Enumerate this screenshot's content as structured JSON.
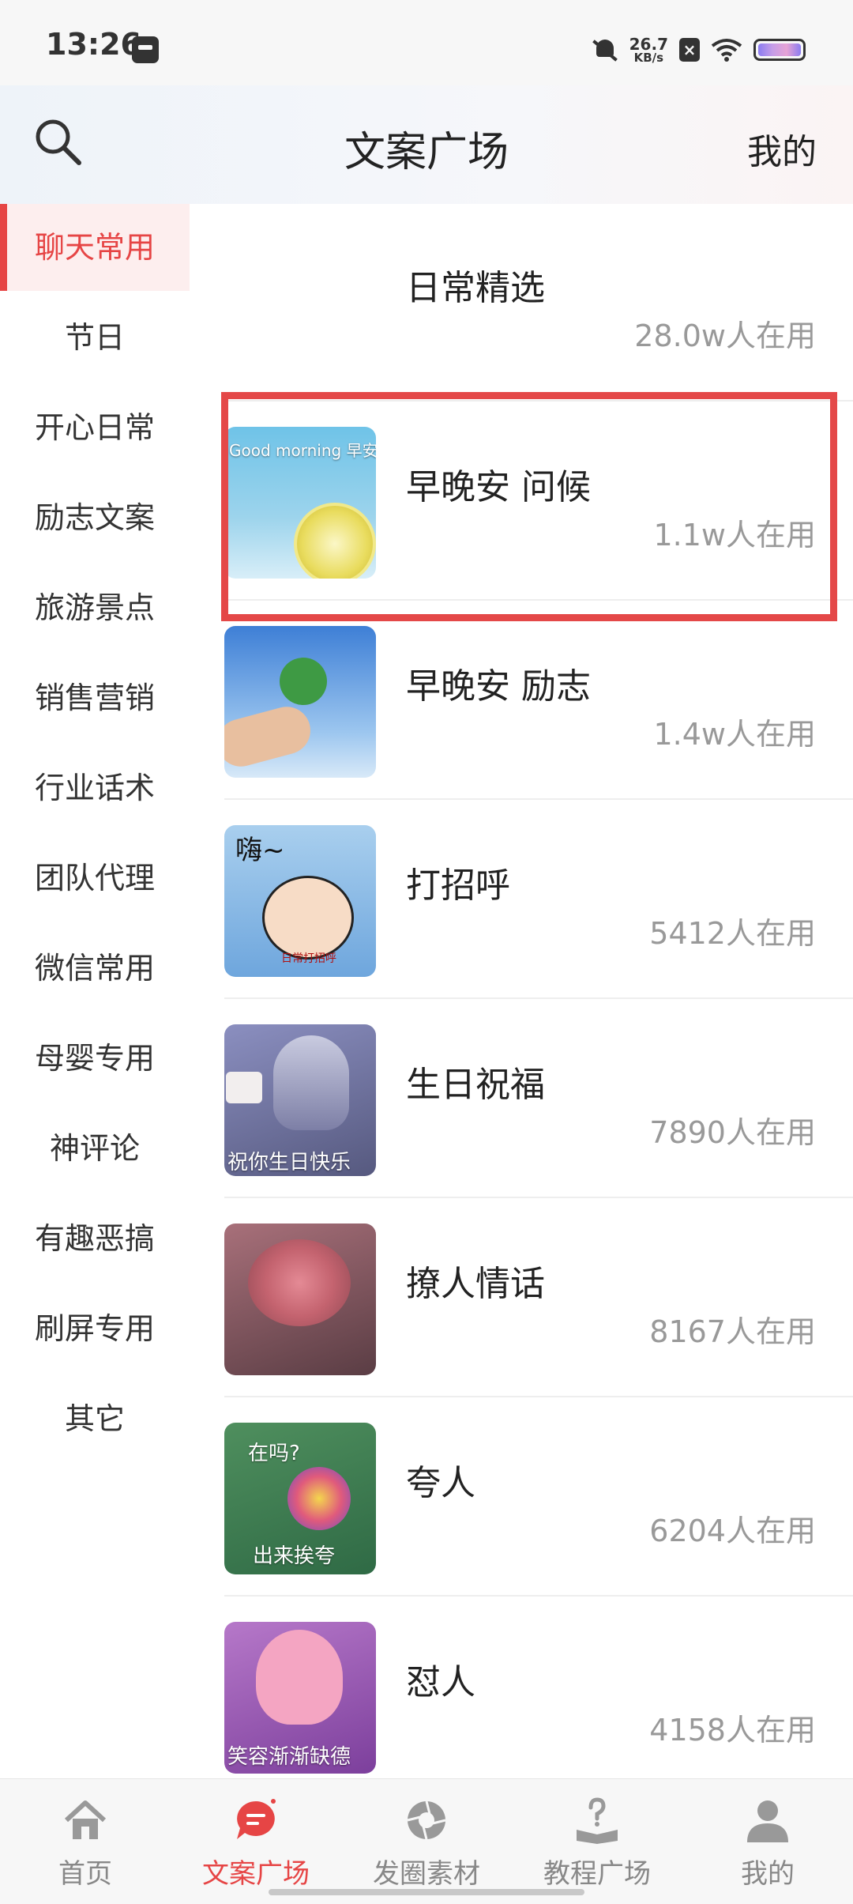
{
  "status_bar": {
    "time": "13:26",
    "net_speed_value": "26.7",
    "net_speed_unit": "KB/s"
  },
  "header": {
    "title": "文案广场",
    "right_link": "我的"
  },
  "sidebar": {
    "items": [
      {
        "label": "聊天常用",
        "active": true
      },
      {
        "label": "节日"
      },
      {
        "label": "开心日常"
      },
      {
        "label": "励志文案"
      },
      {
        "label": "旅游景点"
      },
      {
        "label": "销售营销"
      },
      {
        "label": "行业话术"
      },
      {
        "label": "团队代理"
      },
      {
        "label": "微信常用"
      },
      {
        "label": "母婴专用"
      },
      {
        "label": "神评论"
      },
      {
        "label": "有趣恶搞"
      },
      {
        "label": "刷屏专用"
      },
      {
        "label": "其它"
      }
    ]
  },
  "list": {
    "items": [
      {
        "title": "日常精选",
        "count": "28.0w人在用"
      },
      {
        "title": "早晚安 问候",
        "count": "1.1w人在用",
        "thumb_text": "Good morning\n早安,"
      },
      {
        "title": "早晚安 励志",
        "count": "1.4w人在用"
      },
      {
        "title": "打招呼",
        "count": "5412人在用",
        "thumb_text": "嗨~",
        "thumb_caption": "日常打招呼"
      },
      {
        "title": "生日祝福",
        "count": "7890人在用",
        "thumb_caption": "祝你生日快乐"
      },
      {
        "title": "撩人情话",
        "count": "8167人在用"
      },
      {
        "title": "夸人",
        "count": "6204人在用",
        "thumb_text": "在吗?",
        "thumb_caption": "出来挨夸"
      },
      {
        "title": "怼人",
        "count": "4158人在用",
        "thumb_caption": "笑容渐渐缺德"
      }
    ]
  },
  "bottom_nav": {
    "items": [
      {
        "label": "首页",
        "icon": "home-icon"
      },
      {
        "label": "文案广场",
        "icon": "chat-bubble-icon",
        "active": true
      },
      {
        "label": "发圈素材",
        "icon": "aperture-icon"
      },
      {
        "label": "教程广场",
        "icon": "book-question-icon"
      },
      {
        "label": "我的",
        "icon": "person-icon"
      }
    ]
  },
  "colors": {
    "accent": "#e64545",
    "highlight_box": "#e44848",
    "muted_text": "#999999"
  }
}
